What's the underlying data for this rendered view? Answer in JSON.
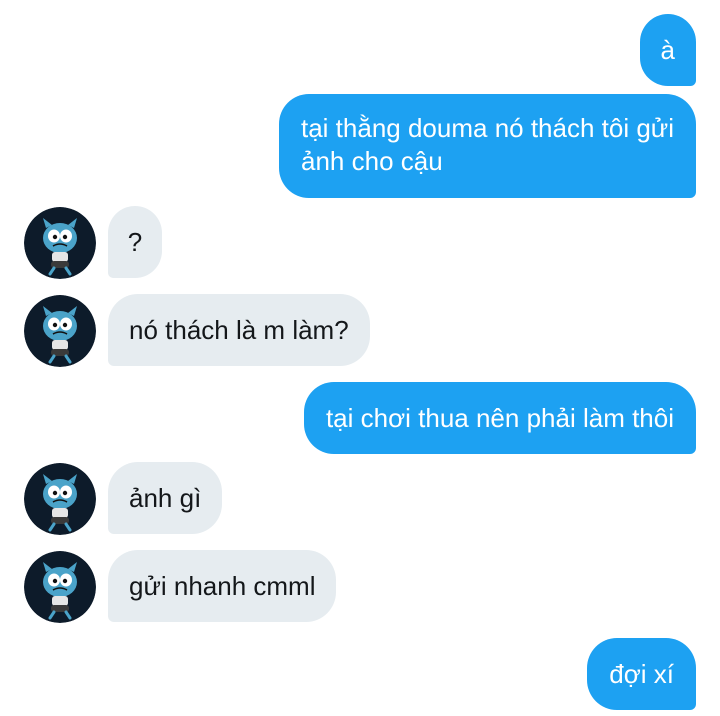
{
  "conversation": {
    "messages": [
      {
        "from": "me",
        "text": "à"
      },
      {
        "from": "me",
        "lines": [
          "tại thằng douma nó thách tôi gửi",
          "ảnh cho cậu"
        ]
      },
      {
        "from": "them",
        "text": "?"
      },
      {
        "from": "them",
        "text": "nó thách là m làm?"
      },
      {
        "from": "me",
        "text": "tại chơi thua nên phải làm thôi"
      },
      {
        "from": "them",
        "text": "ảnh gì"
      },
      {
        "from": "them",
        "text": "gửi nhanh cmml"
      },
      {
        "from": "me",
        "text": "đợi xí"
      }
    ]
  },
  "colors": {
    "outgoing_bubble": "#1da1f2",
    "incoming_bubble": "#e6ecf0",
    "incoming_text": "#14171a",
    "avatar_background": "#0d1b2a"
  },
  "icons": {
    "contact_avatar": "cartoon-blue-cat-avatar"
  }
}
